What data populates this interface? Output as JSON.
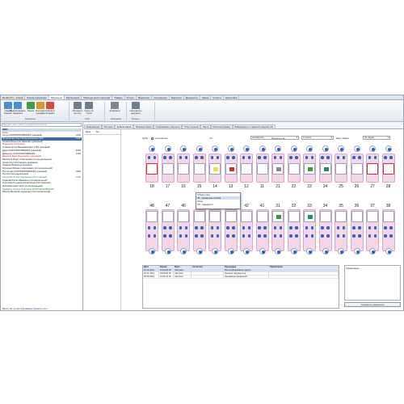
{
  "app": {
    "tabs": [
      "Dentis Pro - Алиса",
      "Режим коррекции",
      "Пациенты",
      "Расписание",
      "Рабочее место кассира",
      "Товары",
      "Услуги",
      "Маркетинг",
      "Сотрудники",
      "Зарплата",
      "Документы",
      "Касса",
      "Отчёты",
      "Настройки"
    ],
    "active_tab": 2
  },
  "ribbon": {
    "buttons": [
      {
        "label": "Новый пациент",
        "icon": "new-patient-icon"
      },
      {
        "label": "Редактировать пациента",
        "icon": "edit-patient-icon"
      },
      {
        "label": "Прием",
        "icon": "money-icon"
      },
      {
        "label": "Быстрая продажа",
        "icon": "cart-icon"
      },
      {
        "label": "Сейчас в Клинике",
        "icon": "clinic-icon"
      },
      {
        "label": "Положить на счет",
        "icon": "deposit-icon"
      },
      {
        "label": "Снять со счета",
        "icon": "withdraw-icon"
      },
      {
        "label": "Компании",
        "icon": "building-icon"
      },
      {
        "label": "Напечатать документ",
        "icon": "print-icon"
      }
    ],
    "groups": [
      "Пациенты",
      "Счёт",
      "Компании",
      "Печать"
    ]
  },
  "left": {
    "search_placeholder": "Введите имя, номер телефона или карты",
    "patients": [
      {
        "name": "ФИО",
        "num": "",
        "style": "head"
      },
      {
        "name": "Гость",
        "num": "",
        "style": ""
      },
      {
        "name": "Артур (КОРПОРАТИВНЫЙ) (разовый)",
        "num": "1236",
        "style": ""
      },
      {
        "name": "Кронингова Ольга Владимировна (VIP)",
        "num": "1236",
        "style": "sel"
      },
      {
        "name": "Азимов Валентин Иванович (разовый)",
        "num": "",
        "style": ""
      },
      {
        "name": "Владимир Антонович",
        "num": "",
        "style": "red"
      },
      {
        "name": "Гуськов Артур Вениаминович (VIP) (разовый)",
        "num": "",
        "style": ""
      },
      {
        "name": "Дина (КОРПОРАТИВНЫЙ) (разовый)",
        "num": "1234",
        "style": ""
      },
      {
        "name": "Джинглер (КОРПОРАТИВНЫЙ)",
        "num": "1234",
        "style": ""
      },
      {
        "name": "Джексон Карл Родионович (разовый)",
        "num": "",
        "style": "red"
      },
      {
        "name": "Баклехов Игнат Спартакович (потенциальный)",
        "num": "",
        "style": ""
      },
      {
        "name": "Клим Олег Рустамович (разовый)",
        "num": "",
        "style": ""
      },
      {
        "name": "Лекарев Всеволод Егорович",
        "num": "",
        "style": ""
      },
      {
        "name": "Мотюнин Михаил Николаевич (потенциальный)",
        "num": "",
        "style": ""
      },
      {
        "name": "Ростислав (КОРПОРАТИВНЫЙ) (разовый)",
        "num": "1236",
        "style": ""
      },
      {
        "name": "Руслан (потенциальный)",
        "num": "",
        "style": ""
      },
      {
        "name": "Соколова Алиса Андреевна (Постоянный)",
        "num": "1236",
        "style": "green"
      },
      {
        "name": "Темкова Юлия Ивановна (потенциальный)",
        "num": "",
        "style": ""
      },
      {
        "name": "Тимохова Сусанна Кирилловна (Постоянный)",
        "num": "",
        "style": ""
      },
      {
        "name": "Фуникова Анастасия (потенциальный)",
        "num": "",
        "style": ""
      },
      {
        "name": "Шуфарос Ульяна Павловна (КОРПОРАТИВНЫЙ)",
        "num": "",
        "style": "green"
      },
      {
        "name": "Яблоко Виталий Андреевич (потенциальный)",
        "num": "",
        "style": ""
      }
    ],
    "footer_text": "Всего: 21, из них 5 активных",
    "footer_link": "Показать всех"
  },
  "right": {
    "tabs": [
      "Информация",
      "История",
      "Зубная карта",
      "Лечащие врачи",
      "Страхование пациента",
      "План лечения",
      "Карта",
      "Рентгенограммы",
      "Информация о пациенте (версия v2)"
    ],
    "active_tab": 2,
    "side_headers": [
      "Дата",
      "Тип"
    ],
    "controls": {
      "teeth_label": "Зубы",
      "permanent_label": "постоянные",
      "state_label": "УС",
      "state_value": "неизвестно",
      "cavity_label": "Полость рта",
      "cavity_value": "в норме",
      "color_label": "Цвет эмали",
      "color_value": "Не задан"
    },
    "upper_numbers": [
      "18",
      "17",
      "16",
      "15",
      "14",
      "13",
      "12",
      "11",
      "21",
      "22",
      "23",
      "24",
      "25",
      "26",
      "27",
      "28"
    ],
    "lower_numbers": [
      "48",
      "47",
      "46",
      "45",
      "44",
      "43",
      "42",
      "41",
      "31",
      "32",
      "33",
      "34",
      "35",
      "36",
      "37",
      "38"
    ],
    "popup": [
      "Зубная ткань",
      "IPL - временная пломба",
      "Свищ",
      "ПП - пародонтит"
    ],
    "table": {
      "columns": [
        "Дата",
        "Время",
        "Врач",
        "Ассистент",
        "Процедура",
        "Примечание"
      ],
      "rows": [
        [
          "20.11.2014",
          "15:00:00.00",
          "Светлый",
          "",
          "Распломбирование одного",
          ""
        ],
        [
          "10.11.2014",
          "15:00:00.00",
          "Светлый",
          "",
          "Лечение пародонтита",
          ""
        ],
        [
          "06.08.2014",
          "10:00:13.00",
          "Светлый",
          "",
          "Наложение временной",
          ""
        ]
      ]
    },
    "notes_label": "Примечание:",
    "save_label": "Сохранить изменения"
  },
  "colors": {
    "selection": "#3a6ea5",
    "tooth_bg": "#f3d6e8",
    "marker_blue": "#2a5fc7",
    "marker_red": "#d72a2a",
    "fill_green": "#1f8a6d",
    "fill_yellow": "#e8e048"
  }
}
